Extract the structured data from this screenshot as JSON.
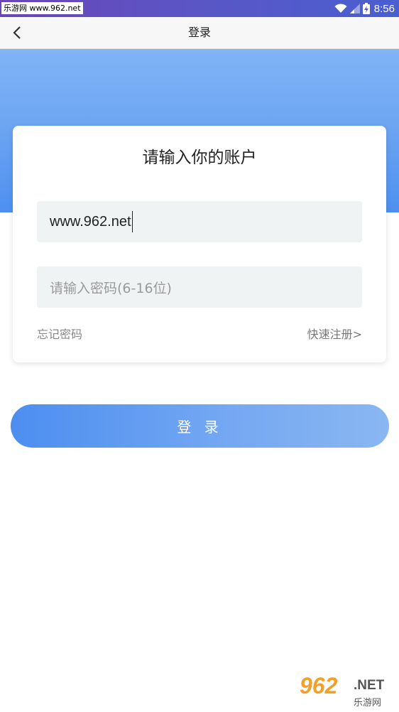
{
  "status_bar": {
    "watermark": "乐游网 www.962.net",
    "time": "8:56"
  },
  "nav": {
    "title": "登录"
  },
  "card": {
    "title": "请输入你的账户",
    "account_value": "www.962.net",
    "password_placeholder": "请输入密码(6-16位)",
    "forgot_label": "忘记密码",
    "register_label": "快速注册>"
  },
  "login_button": {
    "label": "登 录"
  },
  "watermark_bottom": {
    "logo": "962",
    "net": ".NET",
    "sub": "乐游网"
  },
  "icons": {
    "back": "chevron-left-icon",
    "wifi": "wifi-icon",
    "signal": "signal-icon",
    "battery": "battery-charging-icon"
  },
  "colors": {
    "accent": "#4e8ff0",
    "status_bar": "#5a56c6"
  }
}
